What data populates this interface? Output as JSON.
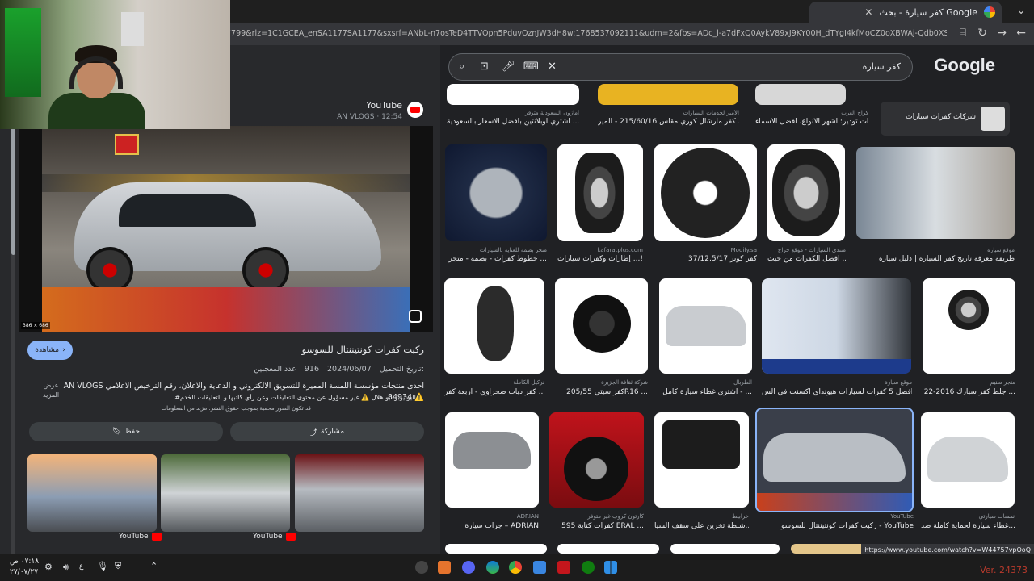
{
  "browser": {
    "tab_title": "كفر سيارة - بحث Google",
    "url": "7799&rlz=1C1GCEA_enSA1177SA1177&sxsrf=ANbL-n7osTeD4TTVOpn5PduvOznJW3dH8w:1768537092111&udm=2&fbs=ADc_l-a7dFxQ0AykV89xJ9KY00H_dTYgI4kfMoCZ0oXBWAj-Qdb0XSGPFLB04uWTnL4PU9NV5...",
    "status_url": "https://www.youtube.com/watch?v=W44757vpOoQ"
  },
  "search": {
    "query": "كفر سيارة",
    "logo": "Google",
    "side_chip_label": "شركات كفرات سيارات"
  },
  "preview": {
    "source_name": "YouTube",
    "source_sub": "AN VLOGS · 12:54",
    "image_dims": "386 × 686",
    "visit_label": "مشاهدة",
    "title": "ركبت كفرات كونتيننتال للسوسو",
    "upload_label": "تاريخ التحميل:",
    "upload_date": "2024/06/07",
    "likes": "916",
    "likes_label": "عدد المعجبين",
    "description": "AN VLOGS احدى منتجات مؤسسة اللمسة المميزة للتسويق الالكتروني و الدعاية والاعلان، رقم الترخيص الاعلامي 84934 ⚠️",
    "description2": "#اليوتيوبر  ابو هلال ⚠️ غير مسؤول عن محتوى التعليقات وعن رأي كاتبها و التعليقات الخدم ...",
    "notice": "قد تكون الصور محمية بموجب حقوق النشر.  مزيد من المعلومات",
    "more_label_1": "عرض",
    "more_label_2": "المزيد",
    "save_label": "حفظ",
    "share_label": "مشاركة",
    "related_1": "YouTube",
    "related_2": "YouTube"
  },
  "results": {
    "row0": [
      {
        "caption": "كفرات تودير: أشهر الأنواع، أفضل الأسماء",
        "source": "كراج العرب"
      },
      {
        "caption": "كفر مارشال كوري مقاس 215/60/16 - المير ...",
        "source": "الأمير لخدمات السيارات"
      },
      {
        "caption": "اشتري اوبلانتين بأفضل الاسعار بالسعودية ...",
        "source": "أمازون السعودية  متوفر"
      }
    ],
    "row1": [
      {
        "caption": "طريقة معرفة تاريخ كفر السيارة | دليل سيارة",
        "source": "موقع سيارة"
      },
      {
        "caption": "أفضل الكفرات من حيث ...",
        "source": "منتدى السيارات - موقع حراج"
      },
      {
        "caption": "كفر كوبر 37/12.5/17",
        "source": "Modify.sa"
      },
      {
        "caption": "إطارات وكفرات سيارات ...!",
        "source": "kafaratplus.com"
      },
      {
        "caption": "خطوط كفرات - بصمة - متجر ...",
        "source": "متجر بصمة للعناية بالسيارات"
      }
    ],
    "row2": [
      {
        "caption": "جلط كفر سبارك 2016-22 ...",
        "source": "متجر سنيم"
      },
      {
        "caption": "أفضل 5 كفرات لسيارات هيونداي اكسنت في الس...",
        "source": "موقع سيارة"
      },
      {
        "caption": "اشتري غطاء سيارة كامل - ...",
        "source": "الطربال"
      },
      {
        "caption": "كفر سيتي 205/55R16 ...",
        "source": "شركة ثقافة الجزيرة"
      },
      {
        "caption": "كفر دباب صحراوي - أربعة كفر ...",
        "source": "نركيل الكاملة"
      }
    ],
    "row3": [
      {
        "caption": "غطاء سيارة لحماية كاملة ضد...",
        "source": "نمسات سيارتي"
      },
      {
        "caption": "ركبت كفرات كونتيننتال للسوسو - YouTube",
        "source": "YouTube"
      },
      {
        "caption": "شنطة تخزين على سقف السيا...",
        "source": "خرابيط"
      },
      {
        "caption": "كفرات كتابة 595 ERAL ...",
        "source": "كارتون كروب  غير متوفر"
      },
      {
        "caption": "جراب سيارة – ADRIAN",
        "source": "ADRIAN"
      }
    ]
  },
  "taskbar": {
    "time": "٠٧:١٨ ص",
    "date": "٢٧/٠٧/٢٧",
    "lang": "ع",
    "version": "Ver. 24373"
  }
}
